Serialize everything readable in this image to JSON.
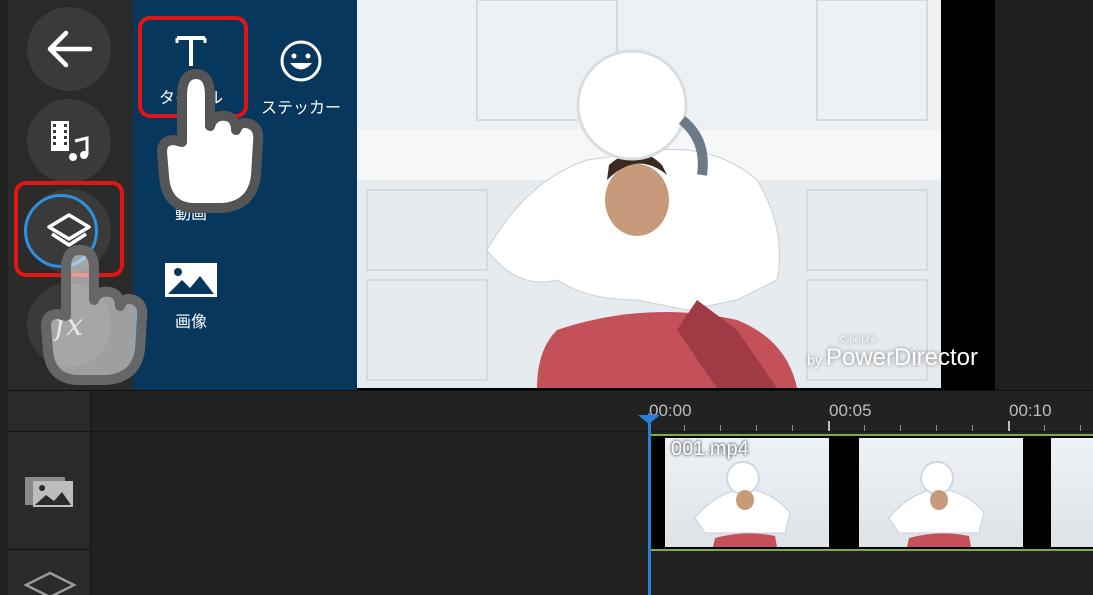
{
  "left_rail": {
    "back_icon": "arrow-left-icon",
    "media_icon": "film-music-icon",
    "layer_icon": "layers-icon",
    "fx_label": "fx"
  },
  "layer_panel": {
    "items": [
      {
        "label": "タイトル",
        "icon": "title-text-icon"
      },
      {
        "label": "ステッカー",
        "icon": "smiley-icon"
      },
      {
        "label": "動画",
        "icon": "video-icon"
      },
      {
        "label": "画像",
        "icon": "image-icon"
      }
    ]
  },
  "preview": {
    "watermark_by": "by",
    "watermark_brand": "PowerDirector",
    "watermark_small": "CyberLink"
  },
  "timeline": {
    "ruler_labels": [
      "00:00",
      "00:05",
      "00:10"
    ],
    "clip_name": "001.mp4",
    "track_icons": [
      "video-track-icon",
      "layer-track-icon"
    ]
  },
  "colors": {
    "accent_blue": "#2a7fd8",
    "panel_blue": "#07375c",
    "highlight_red": "#e01616",
    "clip_green": "#7fb03a"
  }
}
